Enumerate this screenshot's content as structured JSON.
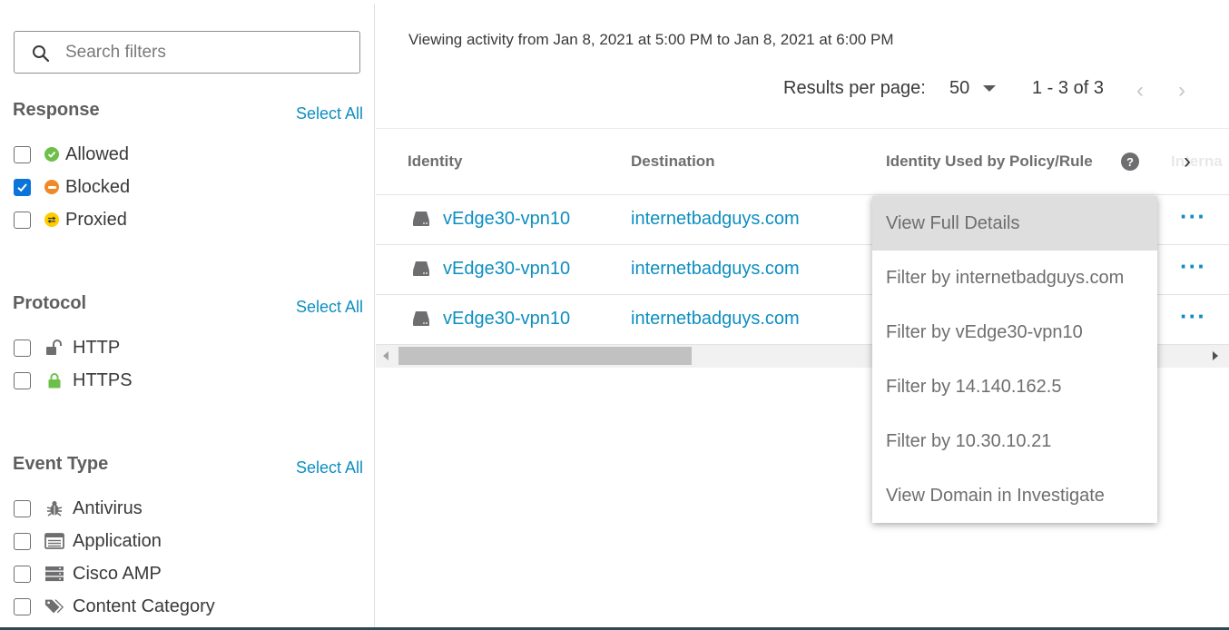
{
  "search": {
    "placeholder": "Search filters"
  },
  "response": {
    "title": "Response",
    "select_all": "Select All",
    "items": [
      {
        "label": "Allowed",
        "checked": false,
        "color": "#6cc04a"
      },
      {
        "label": "Blocked",
        "checked": true,
        "color": "#f0882a"
      },
      {
        "label": "Proxied",
        "checked": false,
        "color": "#ffcc00"
      }
    ]
  },
  "protocol": {
    "title": "Protocol",
    "select_all": "Select All",
    "items": [
      {
        "label": "HTTP",
        "checked": false,
        "icon": "unlock-icon"
      },
      {
        "label": "HTTPS",
        "checked": false,
        "icon": "lock-icon"
      }
    ]
  },
  "event_type": {
    "title": "Event Type",
    "select_all": "Select All",
    "items": [
      {
        "label": "Antivirus",
        "checked": false,
        "icon": "bug-icon"
      },
      {
        "label": "Application",
        "checked": false,
        "icon": "application-icon"
      },
      {
        "label": "Cisco AMP",
        "checked": false,
        "icon": "server-icon"
      },
      {
        "label": "Content Category",
        "checked": false,
        "icon": "tags-icon"
      }
    ]
  },
  "main": {
    "viewing_text": "Viewing activity from Jan 8, 2021 at 5:00 PM to Jan 8, 2021 at 6:00 PM",
    "results_per_page_label": "Results per page:",
    "results_per_page_value": "50",
    "range_text": "1 - 3 of 3",
    "prev_glyph": "‹",
    "next_glyph": "›"
  },
  "table": {
    "columns": [
      "Identity",
      "Destination",
      "Identity Used by Policy/Rule",
      "Interna"
    ],
    "help_glyph": "?",
    "scroll_next_glyph": "›",
    "rows": [
      {
        "identity": "vEdge30-vpn10",
        "destination": "internetbadguys.com",
        "more": "···"
      },
      {
        "identity": "vEdge30-vpn10",
        "destination": "internetbadguys.com",
        "more": "···"
      },
      {
        "identity": "vEdge30-vpn10",
        "destination": "internetbadguys.com",
        "more": "···"
      }
    ]
  },
  "context_menu": {
    "items": [
      {
        "label": "View Full Details",
        "active": true
      },
      {
        "label": "Filter by internetbadguys.com",
        "active": false
      },
      {
        "label": "Filter by vEdge30-vpn10",
        "active": false
      },
      {
        "label": "Filter by 14.140.162.5",
        "active": false
      },
      {
        "label": "Filter by 10.30.10.21",
        "active": false
      },
      {
        "label": "View Domain in Investigate",
        "active": false
      }
    ]
  },
  "colors": {
    "link": "#0d8ec1",
    "checkbox_checked": "#0a74da"
  }
}
